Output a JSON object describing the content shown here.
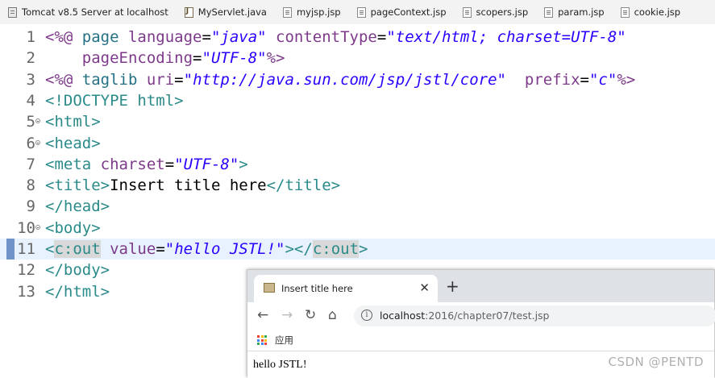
{
  "tabs": [
    {
      "label": "Tomcat v8.5 Server at localhost",
      "icon": "server-icon"
    },
    {
      "label": "MyServlet.java",
      "icon": "java-file-icon"
    },
    {
      "label": "myjsp.jsp",
      "icon": "jsp-file-icon"
    },
    {
      "label": "pageContext.jsp",
      "icon": "jsp-file-icon"
    },
    {
      "label": "scopers.jsp",
      "icon": "jsp-file-icon"
    },
    {
      "label": "param.jsp",
      "icon": "jsp-file-icon"
    },
    {
      "label": "cookie.jsp",
      "icon": "jsp-file-icon"
    }
  ],
  "editor": {
    "current_line": "11",
    "lines": [
      {
        "n": "1",
        "fold": false,
        "parts": [
          [
            "dir",
            "<%@ "
          ],
          [
            "kw",
            "page "
          ],
          [
            "at",
            "language"
          ],
          [
            "txt",
            "="
          ],
          [
            "str",
            "\"java\""
          ],
          [
            "txt",
            " "
          ],
          [
            "at",
            "contentType"
          ],
          [
            "txt",
            "="
          ],
          [
            "str",
            "\"text/html; charset=UTF-8\""
          ]
        ]
      },
      {
        "n": "2",
        "fold": false,
        "parts": [
          [
            "txt",
            "    "
          ],
          [
            "at",
            "pageEncoding"
          ],
          [
            "txt",
            "="
          ],
          [
            "str",
            "\"UTF-8\""
          ],
          [
            "dir",
            "%>"
          ]
        ]
      },
      {
        "n": "3",
        "fold": false,
        "parts": [
          [
            "dir",
            "<%@ "
          ],
          [
            "kw",
            "taglib "
          ],
          [
            "at",
            "uri"
          ],
          [
            "txt",
            "="
          ],
          [
            "str",
            "\"http://java.sun.com/jsp/jstl/core\""
          ],
          [
            "txt",
            "  "
          ],
          [
            "at",
            "prefix"
          ],
          [
            "txt",
            "="
          ],
          [
            "str",
            "\"c\""
          ],
          [
            "dir",
            "%>"
          ]
        ]
      },
      {
        "n": "4",
        "fold": false,
        "parts": [
          [
            "tag",
            "<!DOCTYPE "
          ],
          [
            "tagname",
            "html"
          ],
          [
            "tag",
            ">"
          ]
        ]
      },
      {
        "n": "5",
        "fold": true,
        "parts": [
          [
            "tag",
            "<"
          ],
          [
            "tagname",
            "html"
          ],
          [
            "tag",
            ">"
          ]
        ]
      },
      {
        "n": "6",
        "fold": true,
        "parts": [
          [
            "tag",
            "<"
          ],
          [
            "tagname",
            "head"
          ],
          [
            "tag",
            ">"
          ]
        ]
      },
      {
        "n": "7",
        "fold": false,
        "parts": [
          [
            "tag",
            "<"
          ],
          [
            "tagname",
            "meta "
          ],
          [
            "attr",
            "charset"
          ],
          [
            "txt",
            "="
          ],
          [
            "str",
            "\"UTF-8\""
          ],
          [
            "tag",
            ">"
          ]
        ]
      },
      {
        "n": "8",
        "fold": false,
        "parts": [
          [
            "tag",
            "<"
          ],
          [
            "tagname",
            "title"
          ],
          [
            "tag",
            ">"
          ],
          [
            "txt",
            "Insert title here"
          ],
          [
            "tag",
            "</"
          ],
          [
            "tagname",
            "title"
          ],
          [
            "tag",
            ">"
          ]
        ]
      },
      {
        "n": "9",
        "fold": false,
        "parts": [
          [
            "tag",
            "</"
          ],
          [
            "tagname",
            "head"
          ],
          [
            "tag",
            ">"
          ]
        ]
      },
      {
        "n": "10",
        "fold": true,
        "parts": [
          [
            "tag",
            "<"
          ],
          [
            "tagname",
            "body"
          ],
          [
            "tag",
            ">"
          ]
        ]
      },
      {
        "n": "11",
        "fold": false,
        "parts": [
          [
            "tag",
            "<"
          ],
          [
            "occ",
            "c:out"
          ],
          [
            "txt",
            " "
          ],
          [
            "attr",
            "value"
          ],
          [
            "txt",
            "="
          ],
          [
            "str",
            "\"hello JSTL!\""
          ],
          [
            "tag",
            "></"
          ],
          [
            "occ",
            "c:out"
          ],
          [
            "tag",
            ">"
          ]
        ]
      },
      {
        "n": "12",
        "fold": false,
        "parts": [
          [
            "tag",
            "</"
          ],
          [
            "tagname",
            "body"
          ],
          [
            "tag",
            ">"
          ]
        ]
      },
      {
        "n": "13",
        "fold": false,
        "parts": [
          [
            "tag",
            "</"
          ],
          [
            "tagname",
            "html"
          ],
          [
            "tag",
            ">"
          ]
        ]
      }
    ]
  },
  "browser": {
    "tab_title": "Insert title here",
    "close_glyph": "✕",
    "new_tab_glyph": "+",
    "back_glyph": "←",
    "forward_glyph": "→",
    "reload_glyph": "↻",
    "home_glyph": "⌂",
    "info_glyph": "i",
    "url_host": "localhost",
    "url_path": ":2016/chapter07/test.jsp",
    "bookmark_label": "应用",
    "page_text": "hello JSTL!"
  },
  "watermark": "CSDN @PENTD",
  "colors": {
    "directive": "#7d3a8a",
    "keyword": "#247084",
    "string": "#2a00ff",
    "tag": "#2b8a8a",
    "current_line_bg": "#e8f2fe"
  }
}
